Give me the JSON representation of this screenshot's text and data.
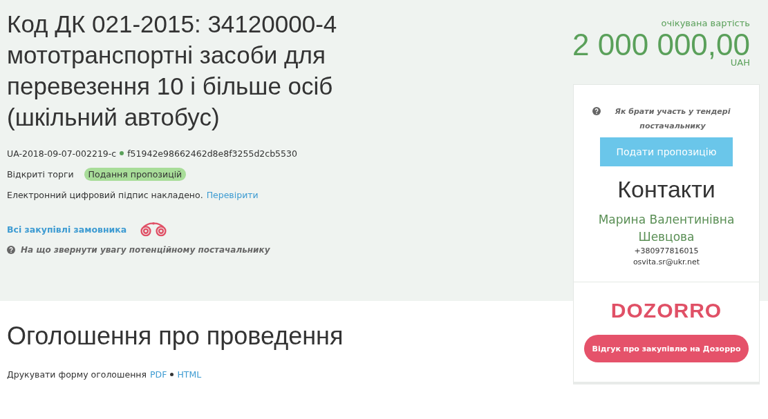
{
  "tender": {
    "title": "Код ДК 021-2015: 34120000-4 мототранспортні засоби для перевезення 10 і більше осіб (шкільний автобус)",
    "id": "UA-2018-09-07-002219-c",
    "hash": "f51942e98662462d8e8f3255d2cb5530",
    "procedure": "Відкриті торги",
    "status": "Подання пропозицій",
    "signature_text": "Електронний цифровий підпис накладено.",
    "signature_link": "Перевірити",
    "buyer_link": "Всі закупівлі замовника",
    "hint": "На що звернути увагу потенційному постачальнику"
  },
  "price": {
    "caption": "очікувана вартість",
    "amount": "2 000 000,00",
    "currency": "UAH"
  },
  "sidebar": {
    "help": "Як брати участь у тендері постачальнику",
    "submit_button": "Подати пропозицію",
    "contacts_title": "Контакти",
    "contact_name": "Марина Валентинівна Шевцова",
    "phone": "+380977816015",
    "email": "osvita.sr@ukr.net",
    "logo": "DOZORRO",
    "review_button": "Відгук про закупівлю на Дозорро"
  },
  "announcement": {
    "title": "Оголошення про проведення",
    "print_label": "Друкувати форму оголошення",
    "formats": [
      "PDF",
      "HTML"
    ]
  }
}
